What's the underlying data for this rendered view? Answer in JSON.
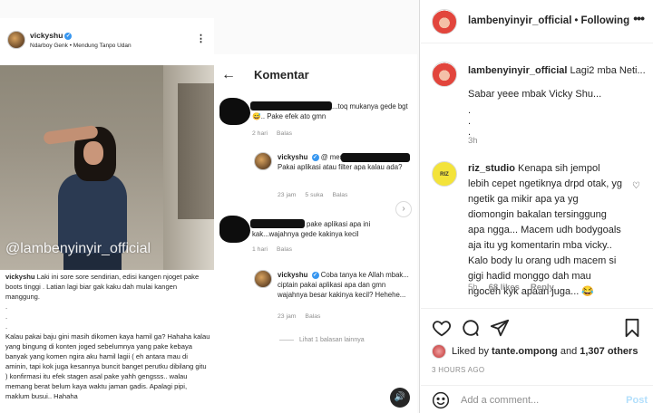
{
  "screenshot": {
    "post": {
      "username": "vickyshu",
      "location": "Ndarboy Genk • Mendung Tanpo Udan",
      "watermark": "@lambenyinyir_official",
      "caption_user": "vickyshu",
      "caption_first": " Laki ini sore sore sendirian, edisi kangen njoget pake boots tinggi . Latian lagi biar gak kaku dah mulai kangen manggung.",
      "caption_dot": ".",
      "caption_body": "Kalau pakai baju gini masih dikomen kaya hamil ga? Hahaha kalau yang bingung di konten joged sebelumnya yang pake kebaya banyak yang komen ngira aku hamil lagii ( eh antara mau di aminin, tapi kok juga kesannya buncit banget perutku dibilang gitu ) konfirmasi itu efek stagen asal pake yahh gengsss.. walau memang berat belum kaya waktu jaman gadis. Apalagi pipi, maklum busui.. Hahaha"
    },
    "comments_panel": {
      "title": "Komentar",
      "back_icon": "←",
      "comments": [
        {
          "text": "...toq mukanya gede bgt 😅.. Pake efek ato gmn",
          "time": "2 hari",
          "reply": "Balas"
        },
        {
          "user": "vickyshu",
          "text": "@ menurut mbak gimana? Pakai aplikasi atau filter apa kalau ada?",
          "time": "23 jam",
          "likes": "5 suka",
          "reply": "Balas"
        },
        {
          "text": "pake aplikasi apa ini kak...wajahnya gede kakinya kecil",
          "time": "1 hari",
          "reply": "Balas"
        },
        {
          "user": "vickyshu",
          "text": "Coba tanya ke Allah mbak... ciptain pakai aplikasi apa dan gmn wajahnya besar kakinya kecil? Hehehe...",
          "time": "23 jam",
          "reply": "Balas"
        }
      ],
      "more_replies": "Lihat 1 balasan lainnya"
    }
  },
  "side": {
    "header": {
      "username": "lambenyinyir_official",
      "dot": "•",
      "follow": "Following",
      "more_icon": "•••"
    },
    "caption": {
      "username": "lambenyinyir_official",
      "text_first": "Lagi2 mba Neti...",
      "line2": "Sabar yeee mbak Vicky Shu...",
      "dot": ".",
      "time": "3h"
    },
    "comment": {
      "username": "riz_studio",
      "avatar_text": "RIZ",
      "text": "Kenapa sih jempol lebih cepet ngetiknya drpd otak, yg ngetik ga mikir apa ya yg diomongin bakalan tersinggung apa ngga... Macem udh bodygoals aja itu yg komentarin mba vicky.. Kalo body lu orang udh macem si gigi hadid monggo dah mau ngoceh kyk apaan juga... 😂",
      "time": "5h",
      "likes": "68 likes",
      "reply": "Reply"
    },
    "likes": {
      "prefix": "Liked by",
      "user": "tante.ompong",
      "and": "and",
      "count": "1,307 others"
    },
    "time_ago": "3 HOURS AGO",
    "add_comment": {
      "placeholder": "Add a comment...",
      "post_label": "Post"
    },
    "icons": [
      "heart-icon",
      "comment-icon",
      "share-icon",
      "bookmark-icon",
      "emoji-icon"
    ]
  }
}
